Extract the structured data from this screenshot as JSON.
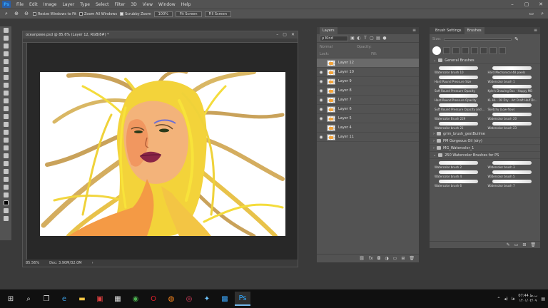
{
  "menubar": {
    "logo": "Ps",
    "items": [
      "File",
      "Edit",
      "Image",
      "Layer",
      "Type",
      "Select",
      "Filter",
      "3D",
      "View",
      "Window",
      "Help"
    ],
    "window_controls": [
      "–",
      "▢",
      "✕"
    ]
  },
  "options": {
    "resize_windows": "Resize Windows to Fit",
    "zoom_all": "Zoom All Windows",
    "scrubby_zoom": "Scrubby Zoom",
    "zoom_level": "100%",
    "fit_screen": "Fit Screen",
    "fill_screen": "Fill Screen"
  },
  "document": {
    "tab_title": "oceanpeee.psd @ 85.6% (Layer 12, RGB/8#) *",
    "zoom": "85.56%",
    "doc_size": "Doc: 3.90M/32.0M"
  },
  "layers_panel": {
    "tab": "Layers",
    "kind": "ρ Kind",
    "blend_mode": "Normal",
    "opacity": "Opacity:",
    "lock": "Lock:",
    "fill": "Fill:",
    "layers": [
      {
        "name": "Layer 12",
        "visible": false,
        "selected": true
      },
      {
        "name": "Layer 10",
        "visible": true,
        "selected": false
      },
      {
        "name": "Layer 9",
        "visible": true,
        "selected": false
      },
      {
        "name": "Layer 8",
        "visible": true,
        "selected": false
      },
      {
        "name": "Layer 7",
        "visible": true,
        "selected": false
      },
      {
        "name": "Layer 6",
        "visible": true,
        "selected": false
      },
      {
        "name": "Layer 5",
        "visible": true,
        "selected": false
      },
      {
        "name": "Layer 4",
        "visible": false,
        "selected": false
      },
      {
        "name": "Layer 11",
        "visible": true,
        "selected": false
      }
    ]
  },
  "brushes_panel": {
    "tabs": [
      "Brush Settings",
      "Brushes"
    ],
    "size_label": "Size:",
    "groups_top": "General Brushes",
    "brush_items": [
      [
        "Watercolor brush 10",
        "Hard Mechanical 48 pixels"
      ],
      [
        "Hard Round Pressure Size",
        "Watercolor brush 1"
      ],
      [
        "Soft Round Pressure Opacity",
        "Kyle's Drawing Box - Happy MB"
      ],
      [
        "Hard Round Pressure Opacity",
        "KL HL - Oil Dry - Art Draft Half Dr..."
      ],
      [
        "Soft Round Pressure Opacity and ...",
        "Sketchy (Low-flow)"
      ],
      [
        "Watercolor Brush 229",
        "Watercolor brush 20"
      ],
      [
        "Watercolor brush 21",
        "Watercolor brush 23"
      ]
    ],
    "groups": [
      "grim_brush_gestBuilme",
      "PM Gorgeous Oil (dry)",
      "MG_Watercolor_1",
      "250 Watercolor Brushes for PS"
    ],
    "brush_items_bottom": [
      [
        "Watercolor brush 2",
        "Watercolor brush 3"
      ],
      [
        "Watercolor brush 4",
        "Watercolor brush 5"
      ],
      [
        "Watercolor brush 6",
        "Watercolor brush 7"
      ]
    ]
  },
  "taskbar": {
    "icons": [
      "windows-icon",
      "search-icon",
      "task-view-icon",
      "edge-icon",
      "file-explorer-icon",
      "app-icon",
      "calculator-icon",
      "chrome-icon",
      "opera-icon",
      "firefox-icon",
      "browser-icon",
      "app2-icon",
      "app3-icon",
      "photoshop-icon"
    ],
    "time": "07:44 ب.ظ",
    "date": "۱۴۰۱/۰۲/۰۹",
    "lang": "فا"
  }
}
